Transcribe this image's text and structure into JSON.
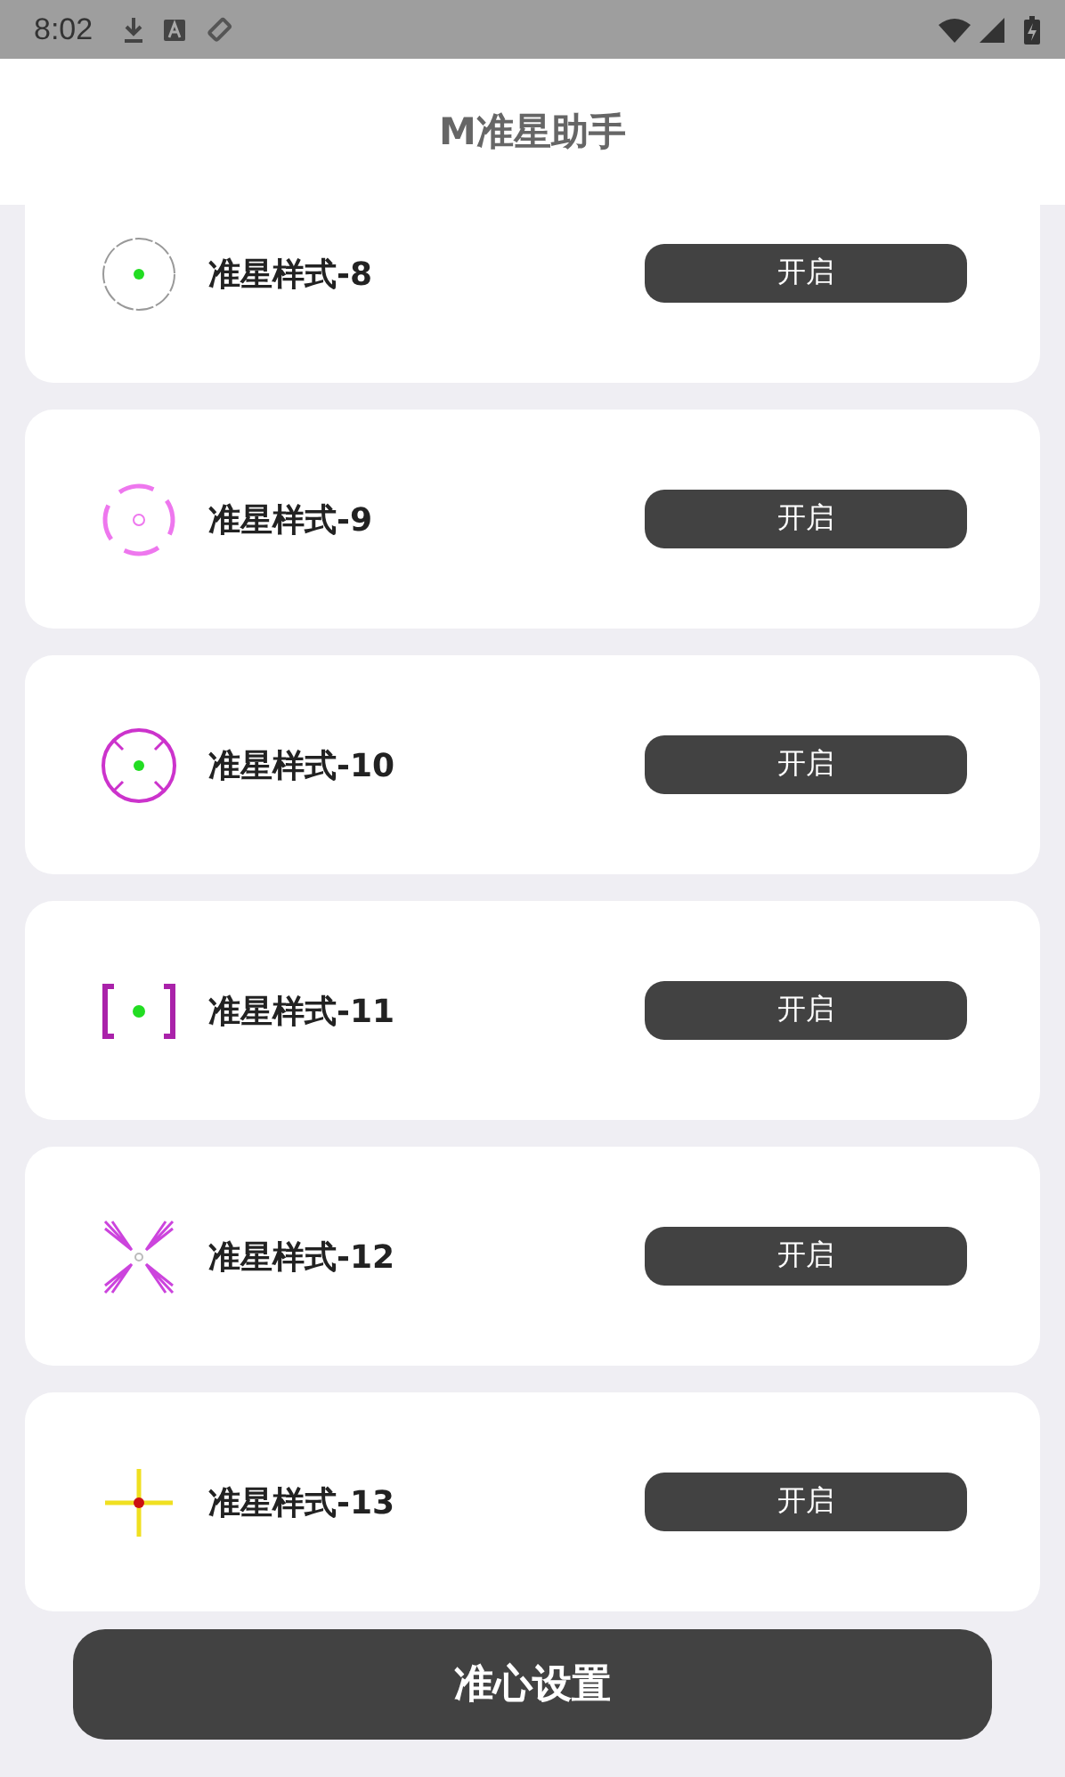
{
  "status_bar": {
    "time": "8:02"
  },
  "header": {
    "title": "M准星助手"
  },
  "styles": [
    {
      "name": "准星样式-8",
      "kind": "ring-dot",
      "button": "开启"
    },
    {
      "name": "准星样式-9",
      "kind": "dashed-ring",
      "button": "开启"
    },
    {
      "name": "准星样式-10",
      "kind": "tick-circle",
      "button": "开启"
    },
    {
      "name": "准星样式-11",
      "kind": "brackets",
      "button": "开启"
    },
    {
      "name": "准星样式-12",
      "kind": "spikes",
      "button": "开启"
    },
    {
      "name": "准星样式-13",
      "kind": "cross",
      "button": "开启"
    }
  ],
  "footer_button": "准心设置"
}
